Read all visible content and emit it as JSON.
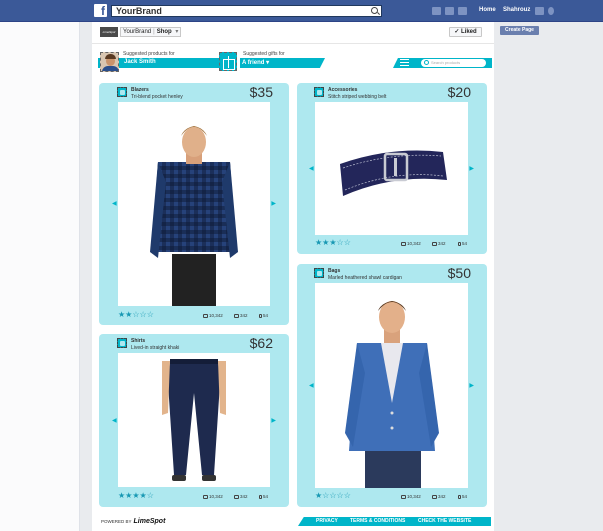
{
  "facebook": {
    "logo": "f",
    "search_value": "YourBrand",
    "nav": [
      "Home",
      "Shahrouz"
    ],
    "create_page": "Create Page"
  },
  "page": {
    "brand_logo": "LimeSpot",
    "breadcrumb": [
      "YourBrand",
      "Shop"
    ],
    "liked": "✓ Liked"
  },
  "widget": {
    "suggested_for_label": "Suggested products for",
    "suggested_for_name": "Jack Smith",
    "gifts_label": "Suggested gifts for",
    "gifts_target": "A friend ▾",
    "search_placeholder": "Search products"
  },
  "products": [
    {
      "category": "Blazers",
      "description": "Tri-blend pocket henley",
      "price": "$35",
      "rating": "★★☆☆☆",
      "likes": "10,342",
      "comments": "342",
      "shares": "54",
      "icon": "tag-icon",
      "image": "model-plaid-shirt"
    },
    {
      "category": "Accessories",
      "description": "Stitch striped webbing belt",
      "price": "$20",
      "rating": "★★★☆☆",
      "likes": "10,342",
      "comments": "342",
      "shares": "54",
      "icon": "belt-icon",
      "image": "navy-belt"
    },
    {
      "category": "Shirts",
      "description": "Lived-in straight khaki",
      "price": "$62",
      "rating": "★★★★☆",
      "likes": "10,342",
      "comments": "342",
      "shares": "54",
      "icon": "shirt-icon",
      "image": "navy-khaki-pants"
    },
    {
      "category": "Bags",
      "description": "Marled heathered shawl cardigan",
      "price": "$50",
      "rating": "★☆☆☆☆",
      "likes": "10,342",
      "comments": "342",
      "shares": "54",
      "icon": "bag-icon",
      "image": "model-blue-cardigan"
    }
  ],
  "footer": {
    "powered_by": "POWERED BY",
    "powered_brand": "LimeSpot",
    "links": [
      "PRIVACY",
      "TERMS & CONDITIONS",
      "CHECK THE WEBSITE"
    ]
  },
  "colors": {
    "facebook_blue": "#3b5998",
    "accent_teal": "#00b5c9",
    "card_bg": "#aee8ef",
    "star_color": "#1798b3"
  }
}
